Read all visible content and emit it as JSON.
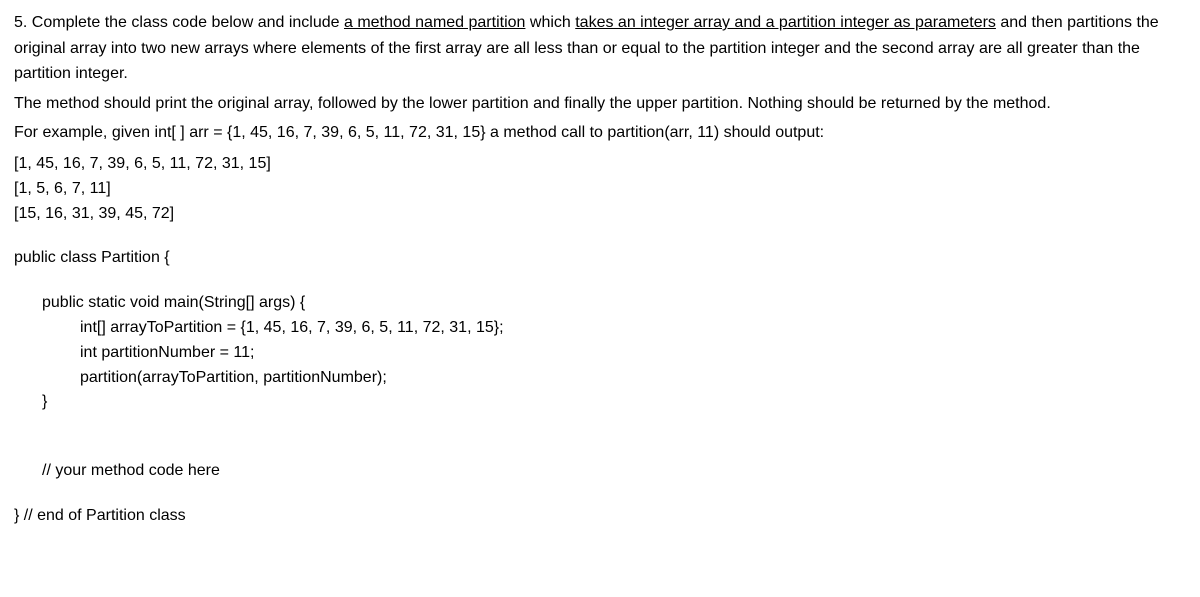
{
  "question": {
    "prefix": "5. Complete the class code below and include ",
    "underlined1": "a method named partition",
    "middle1": " which ",
    "underlined2": "takes an integer array and a partition integer as parameters",
    "suffix1": " and then partitions the original array into two new arrays where elements of the first array are all less than or equal to the partition integer and the second array are all greater than the partition integer."
  },
  "paragraph2": "The method should print the original array, followed by the lower partition and finally the upper partition. Nothing should be returned by the method.",
  "paragraph3": "For example, given int[ ] arr = {1, 45, 16, 7, 39, 6, 5, 11, 72, 31, 15} a method call to partition(arr, 11) should output:",
  "output": {
    "line1": "[1, 45, 16, 7, 39, 6, 5, 11, 72, 31, 15]",
    "line2": "[1, 5, 6, 7, 11]",
    "line3": "[15, 16, 31, 39, 45, 72]"
  },
  "code": {
    "line1": "public class Partition {",
    "line2": "public static void main(String[] args) {",
    "line3": "int[] arrayToPartition = {1, 45, 16, 7, 39, 6, 5, 11, 72, 31, 15};",
    "line4": "int partitionNumber = 11;",
    "line5": "partition(arrayToPartition, partitionNumber);",
    "line6": "}",
    "line7": "// your method code here",
    "line8": "} // end of Partition class"
  }
}
